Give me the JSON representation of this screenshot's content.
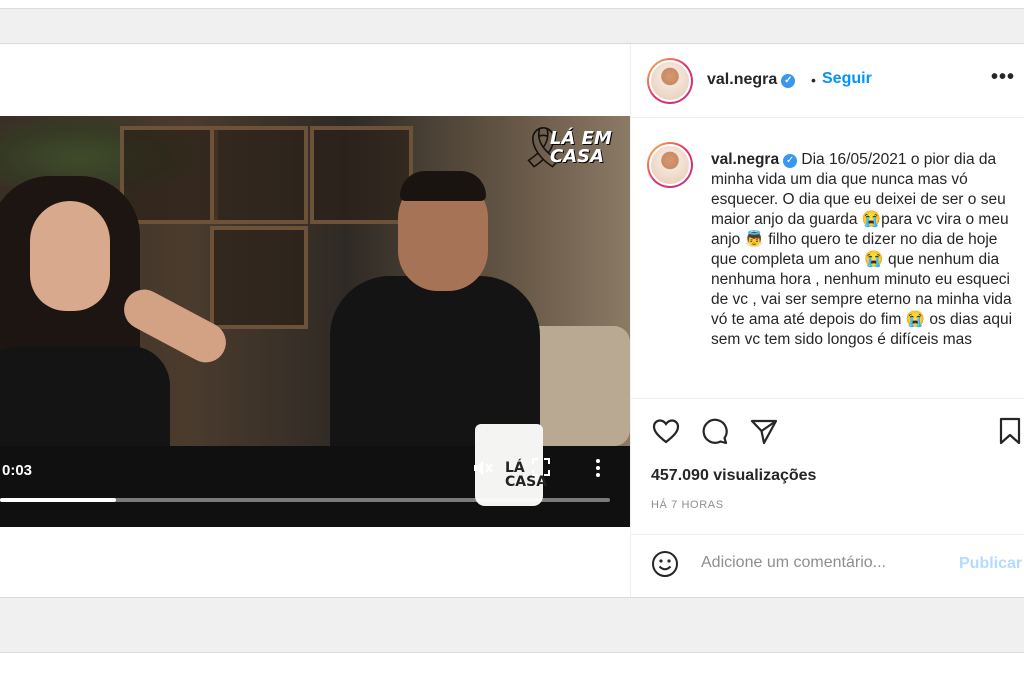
{
  "video": {
    "current_time": "0:03",
    "progress_fraction": 0.19,
    "logo_watermark": "LÁ EM\nCASA",
    "mug_text": "LÁ\nCASA",
    "icons": [
      "mute-icon",
      "fullscreen-icon",
      "more-vert-icon",
      "mourning-ribbon-icon"
    ]
  },
  "post": {
    "author": "val.negra",
    "separator": "•",
    "follow_label": "Seguir",
    "more_label": "•••",
    "caption": "Dia 16/05/2021 o pior dia da minha vida um dia que nunca mas vó esquecer. O dia que eu deixei de ser o seu maior anjo da guarda 😭para vc vira o meu anjo 👼 filho quero te dizer no dia de hoje que completa um ano 😭 que nenhum dia nenhuma hora , nenhum minuto eu esqueci de vc , vai ser sempre eterno na minha vida vó te ama até depois do fim 😭 os dias aqui sem vc tem sido longos é difíceis mas",
    "views": "457.090 visualizações",
    "time_ago": "HÁ 7 HORAS",
    "comment_placeholder": "Adicione um comentário...",
    "publish_label": "Publicar"
  },
  "colors": {
    "accent": "#0095f6",
    "publish_disabled": "#b3dbff",
    "verified": "#3897f0",
    "text": "#262626",
    "muted": "#8e8e8e"
  }
}
